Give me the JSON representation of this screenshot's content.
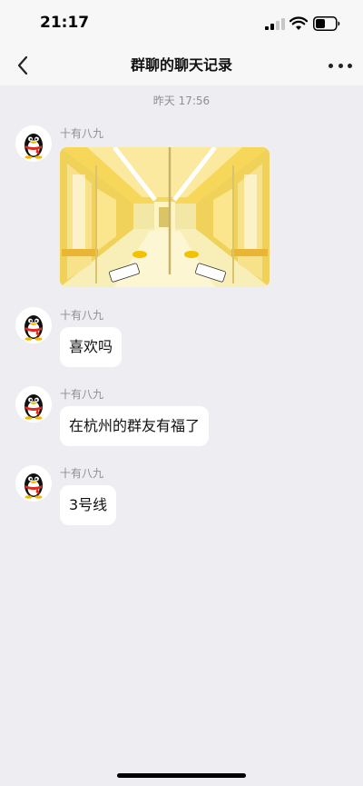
{
  "status_bar": {
    "time": "21:17"
  },
  "nav": {
    "title": "群聊的聊天记录"
  },
  "timestamp": "昨天 17:56",
  "messages": [
    {
      "sender": "十有八九",
      "type": "image",
      "image_desc": "subway-car-interior"
    },
    {
      "sender": "十有八九",
      "type": "text",
      "text": "喜欢吗"
    },
    {
      "sender": "十有八九",
      "type": "text",
      "text": "在杭州的群友有福了"
    },
    {
      "sender": "十有八九",
      "type": "text",
      "text": "3号线"
    }
  ],
  "colors": {
    "background": "#ededf2",
    "bubble": "#ffffff",
    "meta_text": "#8e8e93",
    "accent_yellow": "#f5d648"
  },
  "icons": [
    "back-icon",
    "more-icon",
    "signal-icon",
    "wifi-icon",
    "battery-icon",
    "qq-penguin-avatar"
  ]
}
